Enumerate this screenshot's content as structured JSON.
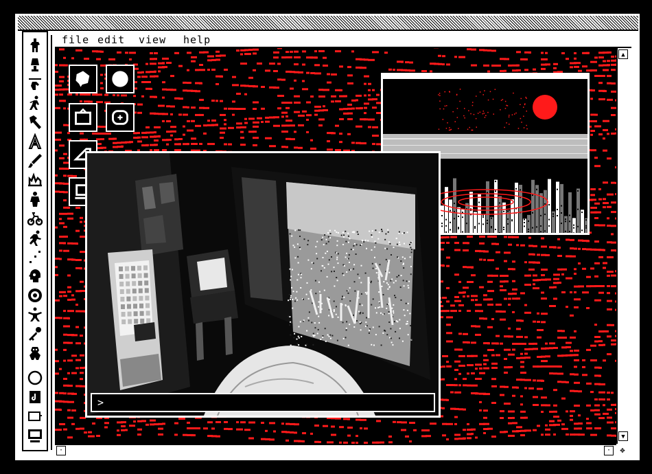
{
  "menu": {
    "file": "file",
    "edit": "edit",
    "view": "view",
    "help": "help"
  },
  "toolbar": {
    "icons": [
      "figure-icon",
      "lamp-icon",
      "hand-icon",
      "walk-icon",
      "hammer-icon",
      "climb-icon",
      "brush-icon",
      "wave-icon",
      "person-icon",
      "bike-icon",
      "run-icon",
      "dots-icon",
      "head-icon",
      "face-icon",
      "dance-icon",
      "key-icon",
      "creature-icon",
      "circle-icon",
      "note-icon",
      "card-icon",
      "monitor-icon"
    ]
  },
  "desktop_icons": [
    "chat-icon",
    "blob-icon",
    "tv-icon",
    "disc-icon",
    "triangle-icon",
    "laptop-icon"
  ],
  "command": {
    "prompt": ">"
  },
  "colors": {
    "accent": "#ff1a1a",
    "background": "#000000",
    "chrome": "#ffffff"
  }
}
